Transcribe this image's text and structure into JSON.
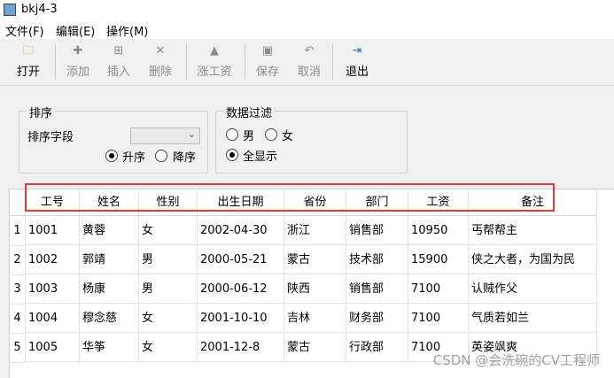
{
  "window": {
    "title": "bkj4-3"
  },
  "menu": [
    "文件(F)",
    "编辑(E)",
    "操作(M)"
  ],
  "toolbar": [
    {
      "label": "打开",
      "icon": "open-folder",
      "glyph": "🗀",
      "enabled": true
    },
    {
      "label": "添加",
      "icon": "add",
      "glyph": "✚",
      "enabled": false
    },
    {
      "label": "插入",
      "icon": "insert",
      "glyph": "⊞",
      "enabled": false
    },
    {
      "label": "删除",
      "icon": "delete",
      "glyph": "✕",
      "enabled": false
    },
    {
      "label": "涨工资",
      "icon": "raise-salary",
      "glyph": "▲",
      "enabled": false
    },
    {
      "label": "保存",
      "icon": "save",
      "glyph": "▣",
      "enabled": false
    },
    {
      "label": "取消",
      "icon": "undo",
      "glyph": "↶",
      "enabled": false
    },
    {
      "label": "退出",
      "icon": "exit",
      "glyph": "⇥",
      "enabled": true
    }
  ],
  "sort": {
    "group_title": "排序",
    "field_label": "排序字段",
    "field_value": "",
    "asc_label": "升序",
    "desc_label": "降序",
    "selected": "升序"
  },
  "filter": {
    "group_title": "数据过滤",
    "male_label": "男",
    "female_label": "女",
    "all_label": "全显示",
    "selected": "全显示"
  },
  "table": {
    "columns": [
      "工号",
      "姓名",
      "性别",
      "出生日期",
      "省份",
      "部门",
      "工资",
      "备注"
    ],
    "rows": [
      {
        "num": "1",
        "cells": [
          "1001",
          "黄蓉",
          "女",
          "2002-04-30",
          "浙江",
          "销售部",
          "10950",
          "丐帮帮主"
        ]
      },
      {
        "num": "2",
        "cells": [
          "1002",
          "郭靖",
          "男",
          "2000-05-21",
          "蒙古",
          "技术部",
          "15900",
          "侠之大者，为国为民"
        ]
      },
      {
        "num": "3",
        "cells": [
          "1003",
          "杨康",
          "男",
          "2000-06-12",
          "陕西",
          "销售部",
          "7100",
          "认贼作父"
        ]
      },
      {
        "num": "4",
        "cells": [
          "1004",
          "穆念慈",
          "女",
          "2001-10-10",
          "吉林",
          "财务部",
          "7100",
          "气质若如兰"
        ]
      },
      {
        "num": "5",
        "cells": [
          "1005",
          "华筝",
          "女",
          "2001-12-8",
          "蒙古",
          "行政部",
          "7100",
          "英姿飒爽"
        ]
      }
    ]
  },
  "watermark": "CSDN @会洗碗的CV工程师",
  "colors": {
    "highlight": "#e53935"
  }
}
